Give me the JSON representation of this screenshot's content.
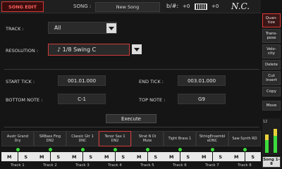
{
  "topbar": {
    "mode": "SONG EDIT",
    "song_label": "SONG :",
    "song_name": "New Song",
    "key_sig": "b/#:",
    "key_value": "+0",
    "transpose_value": "+0",
    "chord": "N.C."
  },
  "main": {
    "track_label": "TRACK :",
    "track_value": "All",
    "resolution_label": "RESOLUTION :",
    "resolution_value": "♪ 1/8 Swing C",
    "start_tick_label": "START TICK :",
    "start_tick_value": "001.01.000",
    "end_tick_label": "END TICK :",
    "end_tick_value": "003.01.000",
    "bottom_note_label": "BOTTOM NOTE :",
    "bottom_note_value": "C-1",
    "top_note_label": "TOP NOTE :",
    "top_note_value": "G9",
    "execute_label": "Execute"
  },
  "right": {
    "quantize": "Quan- tize",
    "transpose": "Trans- pose",
    "velocity": "Velo- city",
    "delete": "Delete",
    "cut_insert": "Cut Insert",
    "copy": "Copy",
    "move": "Move",
    "meter_label": "12",
    "song_tracks": "Song 1-8"
  },
  "tracks": [
    {
      "name1": "Austr Grand",
      "name2": "Dry",
      "mute": "M",
      "solo": "S",
      "num": "Track 1"
    },
    {
      "name1": "SRBass Fing",
      "name2": "DN2",
      "mute": "M",
      "solo": "S",
      "num": "Track 2"
    },
    {
      "name1": "Classic Gtr 1",
      "name2": "DNC",
      "mute": "M",
      "solo": "S",
      "num": "Track 3"
    },
    {
      "name1": "Tenor Sax 1",
      "name2": "DN2",
      "mute": "M",
      "solo": "S",
      "num": "Track 4"
    },
    {
      "name1": "Strat N Di",
      "name2": "Mute",
      "mute": "M",
      "solo": "S",
      "num": "Track 5"
    },
    {
      "name1": "Tight Brass 1",
      "name2": "",
      "mute": "M",
      "solo": "S",
      "num": "Track 6"
    },
    {
      "name1": "StringEnsembl",
      "name2": "eDNC",
      "mute": "M",
      "solo": "S",
      "num": "Track 7"
    },
    {
      "name1": "Saw Synth RD",
      "name2": "",
      "mute": "M",
      "solo": "S",
      "num": "Track 8"
    }
  ],
  "colors": {
    "accent": "#e03a3a",
    "led": "#3ddc3d",
    "meter_green": "#3ddc3d",
    "meter_yellow": "#e8d23a"
  }
}
